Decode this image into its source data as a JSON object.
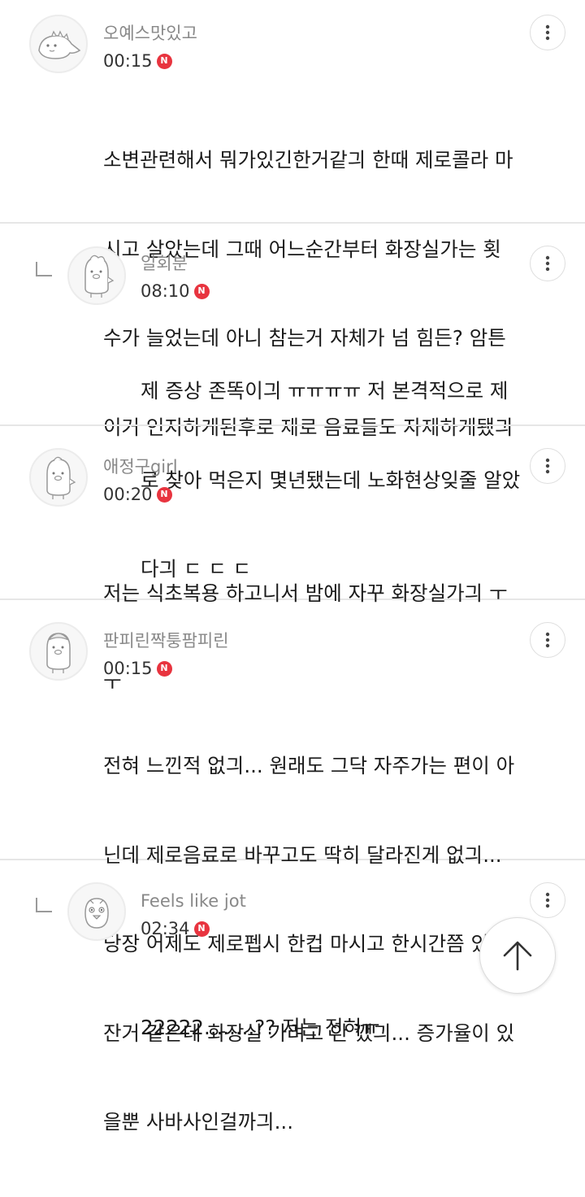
{
  "comments": [
    {
      "author": "오예스맛있고",
      "time": "00:15",
      "badge": "N",
      "lines": [
        "소변관련해서 뭐가있긴한거같긔 한때 제로콜라 마",
        "시고 살았는데 그때 어느순간부터 화장실가는 횟",
        "수가 늘었는데 아니 참는거 자체가 넘 힘든? 암튼",
        "이거 인지하게된후로 제로 음료들도 자제하게됐긔"
      ]
    },
    {
      "author": "일회분",
      "time": "08:10",
      "badge": "N",
      "lines": [
        "제 증상 존똑이긔 ㅠㅠㅠㅠ 저 본격적으로 제",
        "로 찾아 먹은지 몇년됐는데 노화현상잊줄 알았",
        "다긔 ㄷ ㄷ ㄷ"
      ]
    },
    {
      "author": "애정구girl",
      "time": "00:20",
      "badge": "N",
      "lines": [
        "저는 식초복용 하고니서 밤에 자꾸 화장실가긔 ㅜ",
        "ㅜ"
      ]
    },
    {
      "author": "판피린짝퉁팜피린",
      "time": "00:15",
      "badge": "N",
      "lines": [
        "전혀 느낀적 없긔... 원래도 그닥 자주가는 편이 아",
        "닌데 제로음료로 바꾸고도 딱히 달라진게 없긔...",
        "당장 어제도 제로펩시 한컵 마시고 한시간쯤 있다",
        "잔거 같은데 화장실 가려고 안 깼긔... 증가율이 있",
        "을뿐 사바사인걸까긔..."
      ]
    },
    {
      "author": "Feels like jot",
      "time": "02:34",
      "badge": "N",
      "lines": [
        "22222........?? 저는 전혀ㅠ"
      ]
    }
  ],
  "icons": {
    "more": "more-vertical-icon",
    "reply": "reply-corner-icon",
    "scroll_top": "arrow-up-icon",
    "new_badge": "new-badge-icon"
  },
  "colors": {
    "badge": "#e8343f",
    "author": "#888888",
    "divider": "#e6e6e6"
  }
}
